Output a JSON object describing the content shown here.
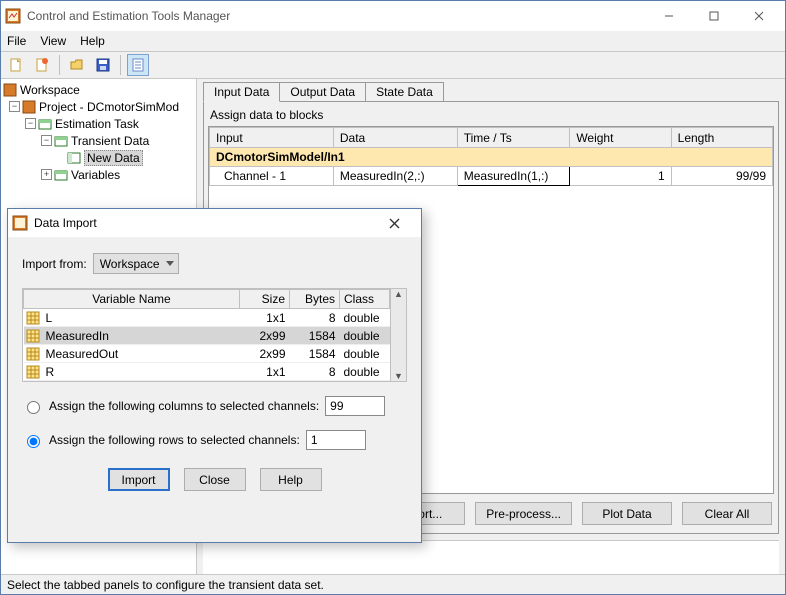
{
  "window": {
    "title": "Control and Estimation Tools Manager"
  },
  "menu": {
    "file": "File",
    "view": "View",
    "help": "Help"
  },
  "tree": {
    "root": "Workspace",
    "project": "Project - DCmotorSimMod",
    "task": "Estimation Task",
    "transient": "Transient Data",
    "newdata": "New Data",
    "variables": "Variables"
  },
  "tabs": {
    "input": "Input Data",
    "output": "Output Data",
    "state": "State Data"
  },
  "panel": {
    "assign": "Assign data to blocks",
    "headers": {
      "input": "Input",
      "data": "Data",
      "time": "Time / Ts",
      "weight": "Weight",
      "length": "Length"
    },
    "group": "DCmotorSimModel/In1",
    "row": {
      "channel": "Channel - 1",
      "data": "MeasuredIn(2,:)",
      "time": "MeasuredIn(1,:)",
      "weight": "1",
      "length": "99/99"
    },
    "buttons": {
      "import": "Import...",
      "preprocess": "Pre-process...",
      "plot": "Plot Data",
      "clear": "Clear All"
    }
  },
  "status": "Select the tabbed panels to configure the transient data set.",
  "dialog": {
    "title": "Data Import",
    "importFromLabel": "Import from:",
    "importFromValue": "Workspace",
    "headers": {
      "name": "Variable Name",
      "size": "Size",
      "bytes": "Bytes",
      "class": "Class"
    },
    "vars": [
      {
        "name": "L",
        "size": "1x1",
        "bytes": "8",
        "class": "double"
      },
      {
        "name": "MeasuredIn",
        "size": "2x99",
        "bytes": "1584",
        "class": "double"
      },
      {
        "name": "MeasuredOut",
        "size": "2x99",
        "bytes": "1584",
        "class": "double"
      },
      {
        "name": "R",
        "size": "1x1",
        "bytes": "8",
        "class": "double"
      }
    ],
    "opt": {
      "cols": "Assign the following columns to selected channels:",
      "colsVal": "99",
      "rows": "Assign the following rows to selected channels:",
      "rowsVal": "1"
    },
    "buttons": {
      "import": "Import",
      "close": "Close",
      "help": "Help"
    }
  }
}
